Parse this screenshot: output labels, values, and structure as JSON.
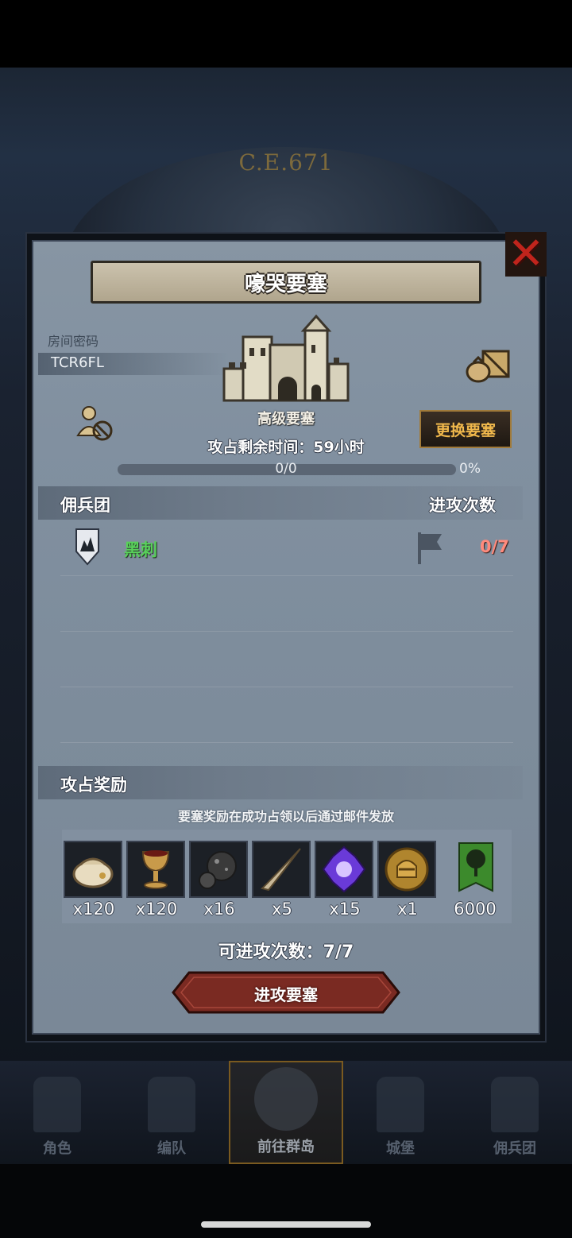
{
  "background": {
    "era_label": "C.E.671"
  },
  "dialog": {
    "title": "嚎哭要塞",
    "room": {
      "label": "房间密码",
      "code": "TCR6FL"
    },
    "fortress": {
      "level": "高级要塞",
      "remaining_time": "攻占剩余时间：59小时",
      "change_button": "更换要塞"
    },
    "progress": {
      "text": "0/0",
      "percent": "0%",
      "value": 0
    },
    "mercenary": {
      "header": "佣兵团",
      "attack_header": "进攻次数",
      "rows": [
        {
          "name": "黑刺",
          "count": "0/7",
          "name_color": "#58d05a",
          "count_color": "#ff8a7c"
        }
      ]
    },
    "rewards": {
      "title": "攻占奖励",
      "note": "要塞奖励在成功占领以后通过邮件发放",
      "items": [
        {
          "icon": "pouch-icon",
          "qty": "x120"
        },
        {
          "icon": "goblet-icon",
          "qty": "x120"
        },
        {
          "icon": "ore-icon",
          "qty": "x16"
        },
        {
          "icon": "horn-icon",
          "qty": "x5"
        },
        {
          "icon": "purple-crystal-icon",
          "qty": "x15"
        },
        {
          "icon": "helmet-medal-icon",
          "qty": "x1"
        },
        {
          "icon": "tree-banner-icon",
          "qty": "6000"
        }
      ]
    },
    "attacks_left": "可进攻次数：7/7",
    "attack_button": "进攻要塞"
  },
  "nav": {
    "items": [
      {
        "label": "角色",
        "icon": "knight-icon"
      },
      {
        "label": "编队",
        "icon": "helmet-icon"
      },
      {
        "label": "前往群岛",
        "icon": "island-map-icon",
        "active": true
      },
      {
        "label": "城堡",
        "icon": "castle-icon"
      },
      {
        "label": "佣兵团",
        "icon": "mercenary-icon"
      }
    ]
  },
  "colors": {
    "accent_gold": "#f0b84c",
    "close_red": "#c0241c",
    "button_red": "#7a2a22"
  }
}
